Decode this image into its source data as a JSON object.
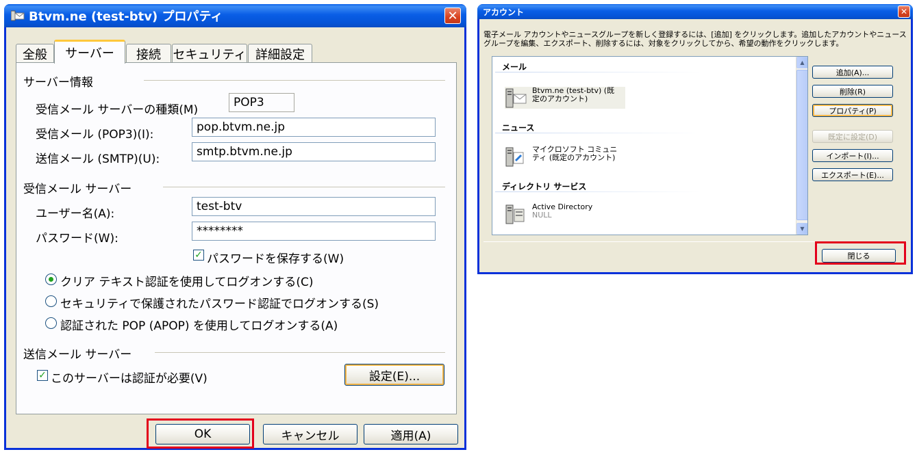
{
  "properties_dialog": {
    "title": "Btvm.ne (test-btv) プロパティ",
    "tabs": [
      "全般",
      "サーバー",
      "接続",
      "セキュリティ",
      "詳細設定"
    ],
    "active_tab": "サーバー",
    "server_info": {
      "heading": "サーバー情報",
      "incoming_type_label": "受信メール サーバーの種類(M)",
      "incoming_type_value": "POP3",
      "incoming_label": "受信メール (POP3)(I):",
      "incoming_value": "pop.btvm.ne.jp",
      "outgoing_label": "送信メール (SMTP)(U):",
      "outgoing_value": "smtp.btvm.ne.jp"
    },
    "incoming_server": {
      "heading": "受信メール サーバー",
      "username_label": "ユーザー名(A):",
      "username_value": "test-btv",
      "password_label": "パスワード(W):",
      "password_value": "********",
      "remember_password_label": "パスワードを保存する(W)",
      "remember_password_checked": true,
      "auth_options": [
        "クリア テキスト認証を使用してログオンする(C)",
        "セキュリティで保護されたパスワード認証でログオンする(S)",
        "認証された POP (APOP) を使用してログオンする(A)"
      ],
      "selected_auth_index": 0
    },
    "outgoing_server": {
      "heading": "送信メール サーバー",
      "requires_auth_label": "このサーバーは認証が必要(V)",
      "requires_auth_checked": true,
      "settings_button": "設定(E)..."
    },
    "buttons": {
      "ok": "OK",
      "cancel": "キャンセル",
      "apply": "適用(A)"
    }
  },
  "accounts_dialog": {
    "title": "アカウント",
    "description": "電子メール アカウントやニュースグループを新しく登録するには、[追加] をクリックします。追加したアカウントやニュースグループを編集、エクスポート、削除するには、対象をクリックしてから、希望の動作をクリックします。",
    "sections": [
      {
        "heading": "メール",
        "account": "Btvm.ne (test-btv) (既定のアカウント)",
        "sub": ""
      },
      {
        "heading": "ニュース",
        "account": "マイクロソフト コミュニティ (既定のアカウント)",
        "sub": ""
      },
      {
        "heading": "ディレクトリ サービス",
        "account": "Active Directory",
        "sub": "NULL"
      }
    ],
    "buttons": {
      "add": "追加(A)...",
      "remove": "削除(R)",
      "properties": "プロパティ(P)",
      "set_default": "既定に設定(D)",
      "import": "インポート(I)...",
      "export": "エクスポート(E)...",
      "close": "閉じる"
    }
  },
  "colors": {
    "highlight": "#e3001b",
    "title_bar": "#0a5ee6",
    "dialog_face": "#ece9d8"
  }
}
